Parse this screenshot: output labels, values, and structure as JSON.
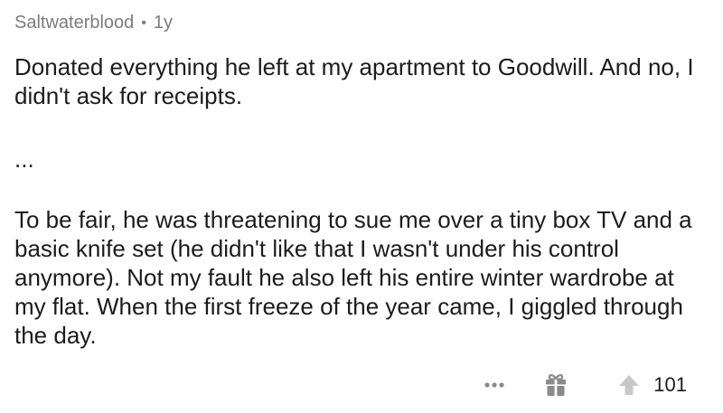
{
  "comment": {
    "author": "Saltwaterblood",
    "separator": "•",
    "age": "1y",
    "paragraph1": "Donated everything he left at my apartment to Goodwill.  And no, I didn't ask for receipts.",
    "ellipsis": "...",
    "paragraph2": "To be fair, he was threatening to sue me over a tiny box TV and a basic knife set (he didn't like that I wasn't under his control anymore).  Not my fault he also left his entire winter wardrobe at my flat.  When the first freeze of the year came, I giggled through the day."
  },
  "actions": {
    "more_icon": "more-options-icon",
    "gift_icon": "gift-icon",
    "upvote_icon": "upvote-arrow-icon",
    "score": "101"
  },
  "colors": {
    "meta_text": "#7c7c7c",
    "body_text": "#1c1c1c",
    "icon_gray": "#8a8a8a",
    "upvote_light": "#c8c8c8"
  }
}
